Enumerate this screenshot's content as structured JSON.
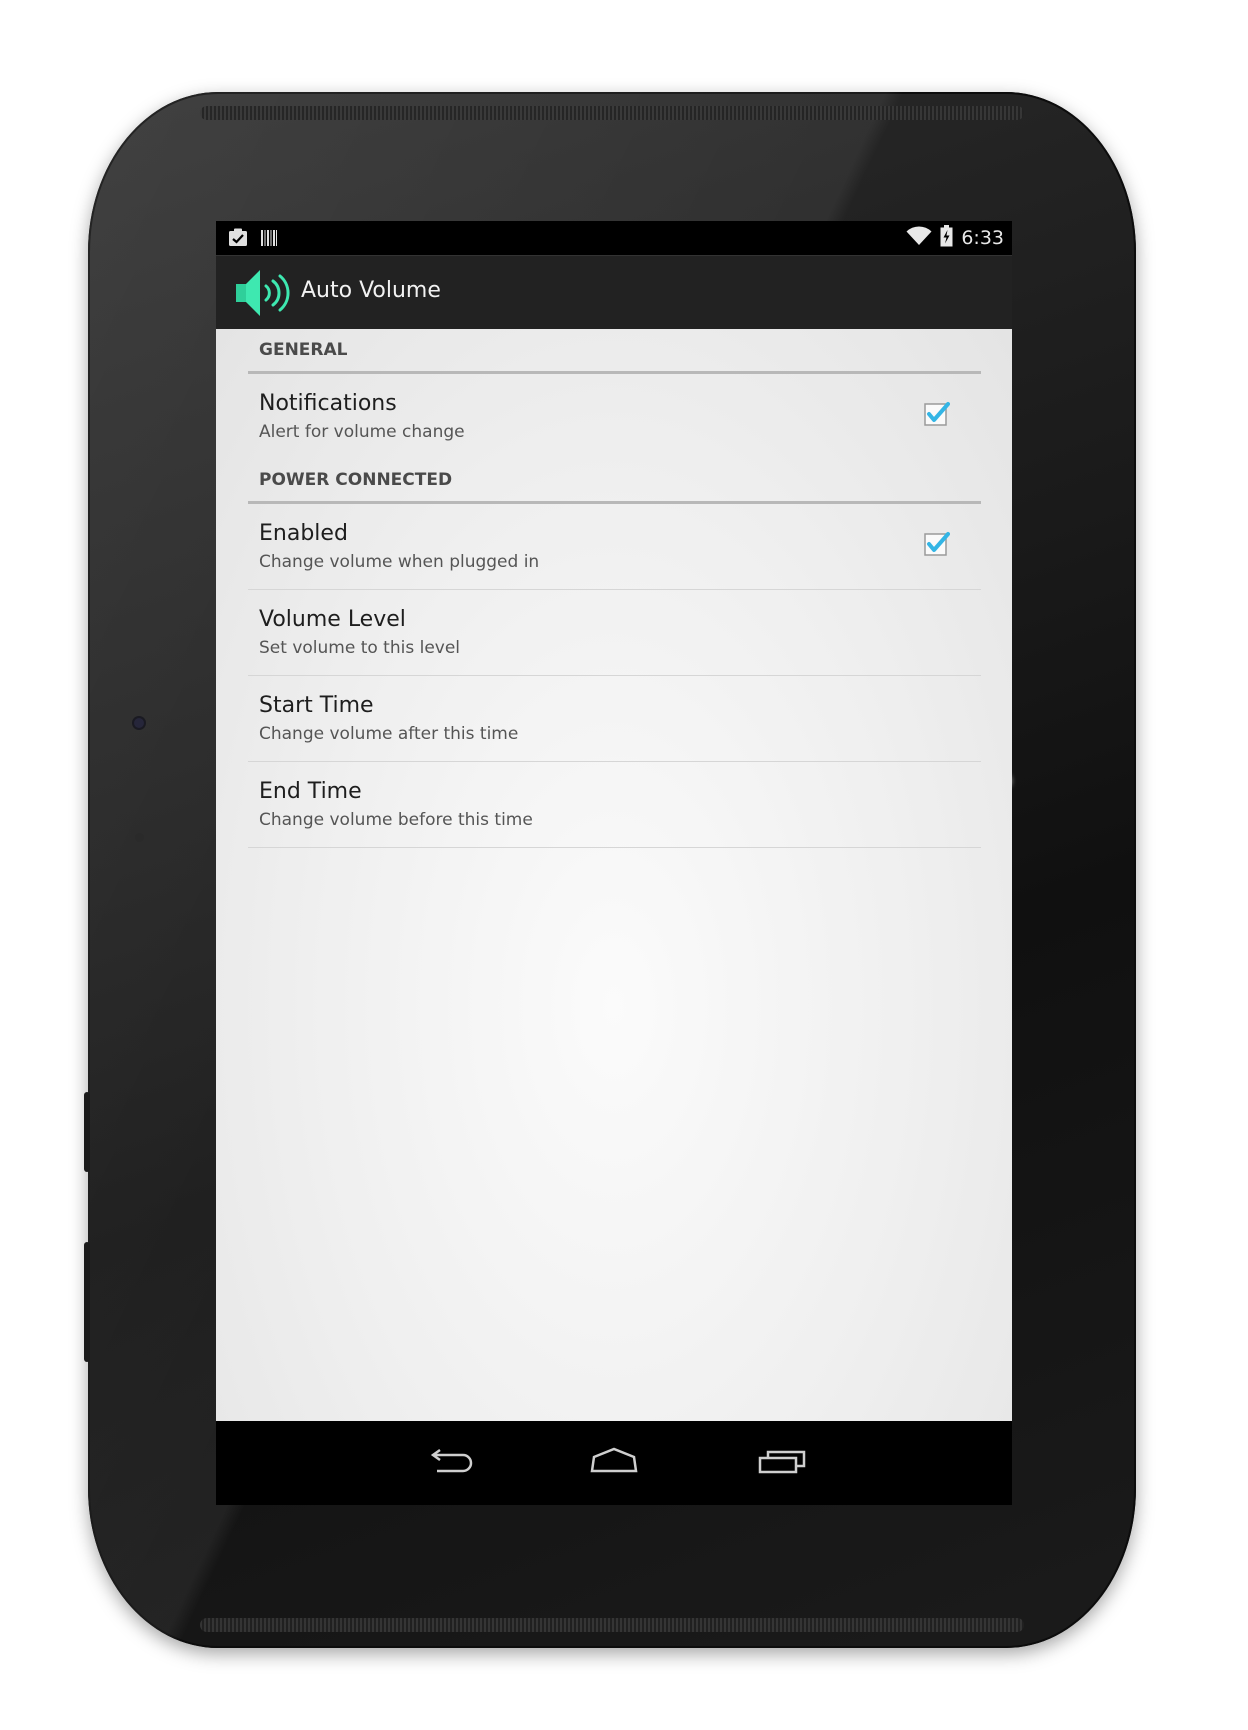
{
  "status_bar": {
    "time": "6:33",
    "left_icons": [
      "clipboard-check-icon",
      "barcode-icon"
    ],
    "right_icons": [
      "wifi-icon",
      "battery-charging-icon"
    ]
  },
  "action_bar": {
    "title": "Auto Volume",
    "icon": "speaker-volume-icon",
    "icon_color": "#3ee8b0"
  },
  "preferences": {
    "general": {
      "header": "GENERAL",
      "notifications": {
        "title": "Notifications",
        "summary": "Alert for volume change",
        "checked": true
      }
    },
    "power_connected": {
      "header": "POWER CONNECTED",
      "enabled": {
        "title": "Enabled",
        "summary": "Change volume when plugged in",
        "checked": true
      },
      "volume_level": {
        "title": "Volume Level",
        "summary": "Set volume to this level"
      },
      "start_time": {
        "title": "Start Time",
        "summary": "Change volume after this time"
      },
      "end_time": {
        "title": "End Time",
        "summary": "Change volume before this time"
      }
    }
  },
  "nav_bar": {
    "buttons": [
      "back-icon",
      "home-icon",
      "recent-apps-icon"
    ]
  },
  "colors": {
    "checkbox_check": "#33b5e5",
    "accent": "#3ee8b0"
  }
}
